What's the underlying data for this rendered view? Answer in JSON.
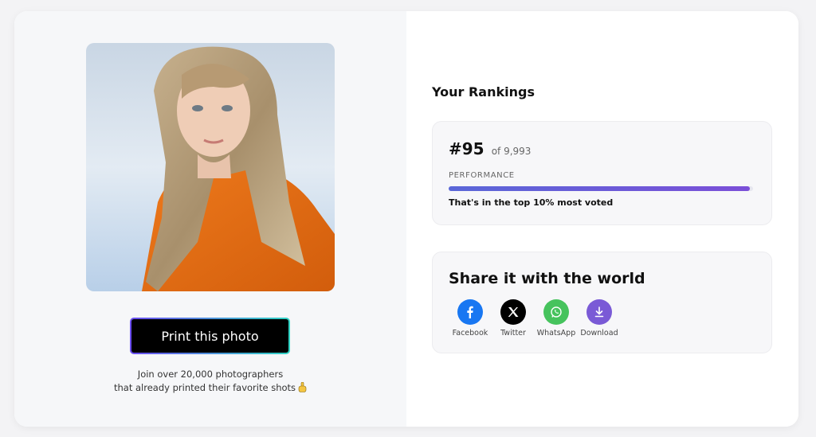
{
  "print_button": {
    "label": "Print this photo"
  },
  "join_text": {
    "line1": "Join over 20,000 photographers",
    "line2": "that already printed their favorite shots"
  },
  "rankings": {
    "title": "Your Rankings",
    "rank": "#95",
    "of_total": "of 9,993",
    "performance_label": "PERFORMANCE",
    "performance_fraction": 0.99,
    "summary": "That's in the top 10% most voted"
  },
  "share": {
    "title": "Share it with the world",
    "items": [
      {
        "label": "Facebook",
        "icon": "facebook-icon",
        "color": "#1877f2"
      },
      {
        "label": "Twitter",
        "icon": "x-icon",
        "color": "#000000"
      },
      {
        "label": "WhatsApp",
        "icon": "whatsapp-icon",
        "color": "#46c35d"
      },
      {
        "label": "Download",
        "icon": "download-icon",
        "color": "#7a5ad6"
      }
    ]
  },
  "colors": {
    "accent_gradient_start": "#5a67d8",
    "accent_gradient_end": "#7b4fd8",
    "button_border_start": "#6a4cf0",
    "button_border_end": "#2fd3c4"
  }
}
